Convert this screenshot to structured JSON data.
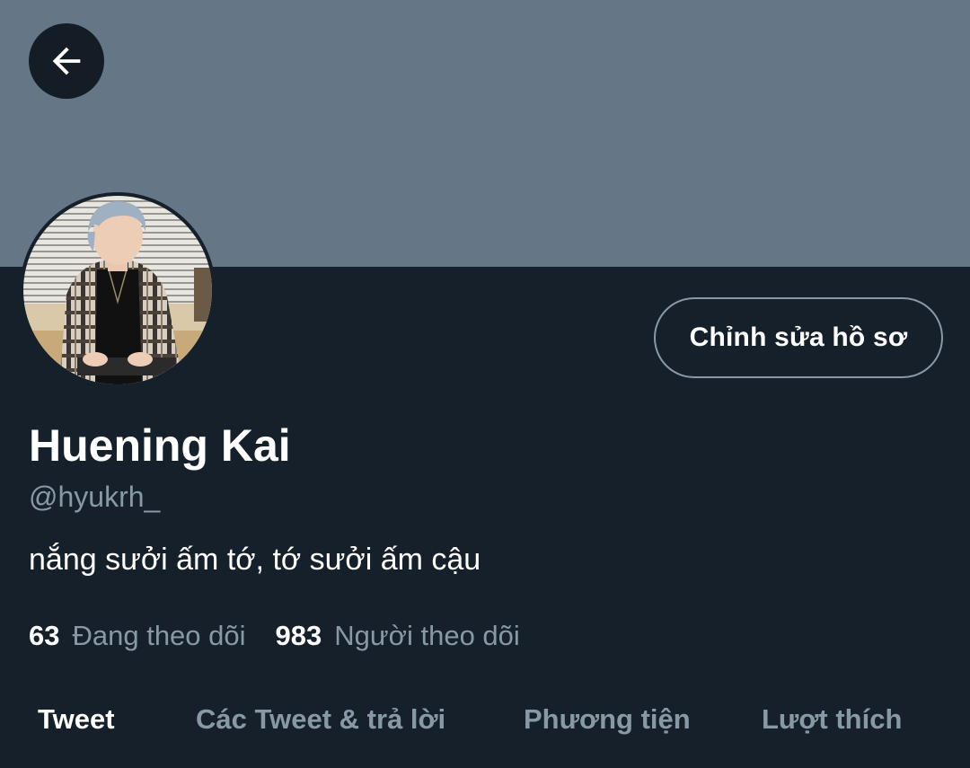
{
  "header": {
    "back_icon": "arrow-left-icon"
  },
  "profile": {
    "avatar_icon": "profile-photo",
    "edit_button_label": "Chỉnh sửa hồ sơ",
    "name": "Huening Kai",
    "handle": "@hyukrh_",
    "bio": "nắng sưởi ấm tớ, tớ sưởi ấm cậu",
    "following_count": "63",
    "following_label": "Đang theo dõi",
    "followers_count": "983",
    "followers_label": "Người theo dõi"
  },
  "tabs": [
    {
      "label": "Tweet",
      "active": true
    },
    {
      "label": "Các Tweet & trả lời",
      "active": false
    },
    {
      "label": "Phương tiện",
      "active": false
    },
    {
      "label": "Lượt thích",
      "active": false
    }
  ],
  "colors": {
    "background": "#15202b",
    "banner": "#657786",
    "secondary_text": "#8899a6",
    "primary_text": "#ffffff"
  }
}
